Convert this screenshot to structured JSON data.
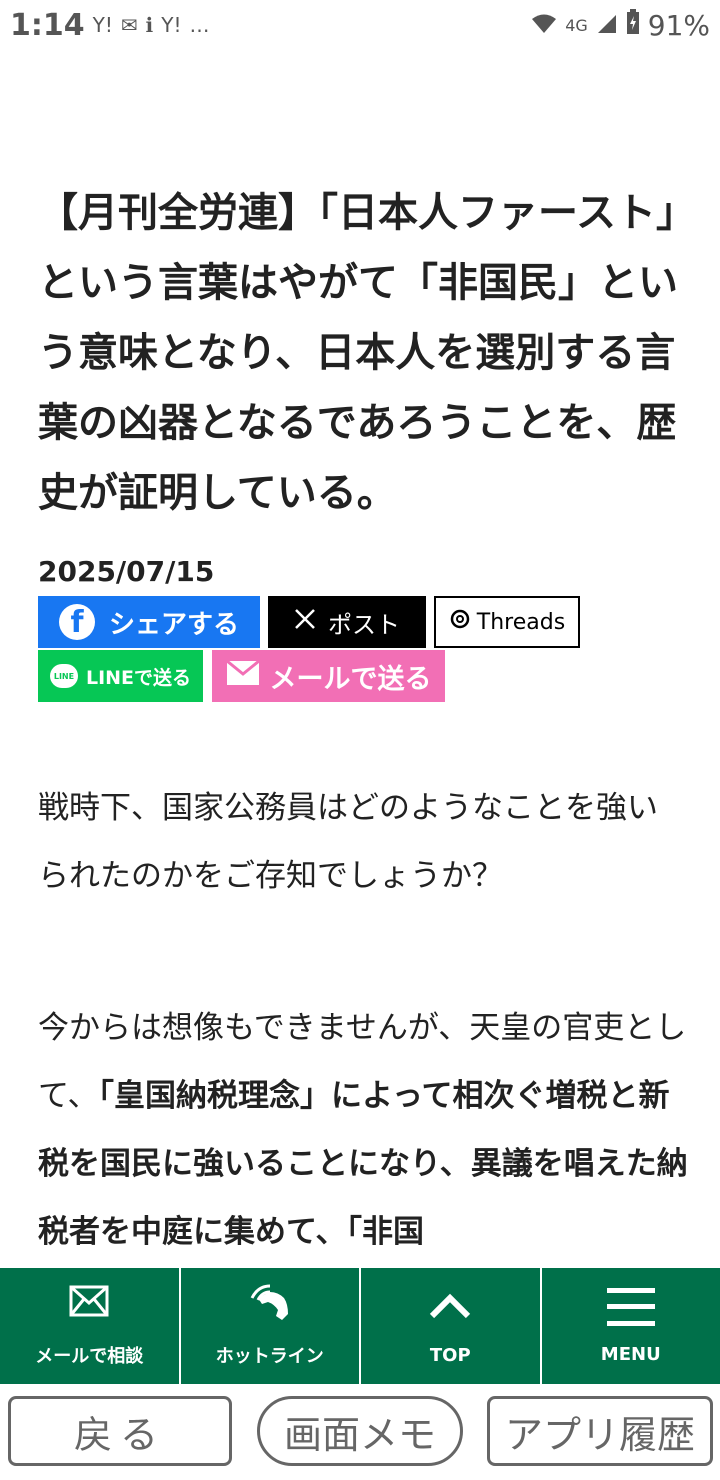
{
  "status_bar": {
    "time": "1:14",
    "left_icons": [
      "Y!",
      "✉",
      "ℹ",
      "Y!",
      "…"
    ],
    "network": "4G",
    "battery": "91%"
  },
  "article": {
    "title": "【月刊全労連】「日本人ファースト」という言葉はやがて「非国民」という意味となり、日本人を選別する言葉の凶器となるであろうことを、歴史が証明している。",
    "date": "2025/07/15",
    "share": {
      "facebook": "シェアする",
      "x": "ポスト",
      "threads": "Threads",
      "line": "LINEで送る",
      "mail": "メールで送る"
    },
    "paragraph1": "戦時下、国家公務員はどのようなことを強いられたのかをご存知でしょうか？",
    "paragraph2_normal": "今からは想像もできませんが、天皇の官吏として、",
    "paragraph2_bold": "「皇国納税理念」によって相次ぐ増税と新税を国民に強いることになり、異議を唱えた納税者を中庭に集めて、「非国"
  },
  "bottom_nav": {
    "mail": "メールで相談",
    "hotline": "ホットライン",
    "top": "TOP",
    "menu": "MENU"
  },
  "browser_bar": {
    "back": "戻る",
    "memo": "画面メモ",
    "history": "アプリ履歴"
  },
  "colors": {
    "nav_green": "#00704a",
    "facebook": "#1877f2",
    "line": "#06c755",
    "mail_pink": "#f26fb5"
  }
}
